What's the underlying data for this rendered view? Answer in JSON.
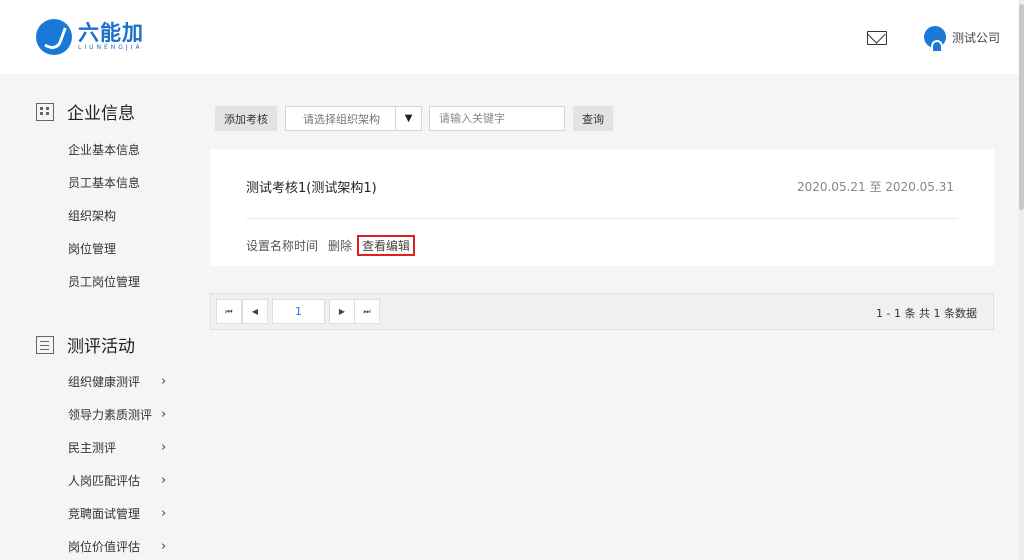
{
  "header": {
    "logo_cn": "六能加",
    "logo_en": "LIUNENGJIA",
    "company": "测试公司"
  },
  "sidebar": {
    "sections": [
      {
        "title": "企业信息",
        "items": [
          "企业基本信息",
          "员工基本信息",
          "组织架构",
          "岗位管理",
          "员工岗位管理"
        ]
      },
      {
        "title": "测评活动",
        "items": [
          "组织健康测评",
          "领导力素质测评",
          "民主测评",
          "人岗匹配评估",
          "竞聘面试管理",
          "岗位价值评估"
        ],
        "chevron": "›"
      }
    ]
  },
  "toolbar": {
    "add_label": "添加考核",
    "select_value": "请选择组织架构",
    "select_arrow": "▼",
    "keyword_placeholder": "请输入关键字",
    "query_label": "查询"
  },
  "card": {
    "name": "测试考核1(测试架构1)",
    "date_range": "2020.05.21 至 2020.05.31",
    "actions": [
      "设置名称时间",
      "删除",
      "查看编辑"
    ]
  },
  "pager": {
    "first": "⏮",
    "prev": "◀",
    "page": "1",
    "next": "▶",
    "last": "⏭",
    "summary": "1 - 1 条   共 1 条数据"
  },
  "colors": {
    "brand": "#1a78d6",
    "highlight": "#e02020"
  }
}
